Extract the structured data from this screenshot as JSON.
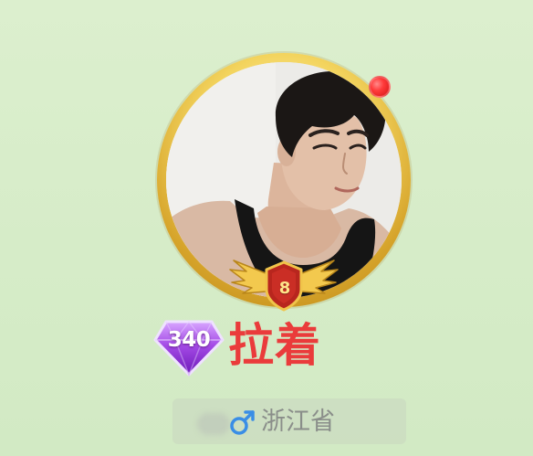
{
  "profile": {
    "username": "拉着",
    "level": "8",
    "gem_level": "340",
    "gender": "male",
    "location": "浙江省",
    "has_notification": true
  },
  "colors": {
    "background": "#d8edca",
    "username": "#ea3b3b",
    "avatar_ring": "#e8c24a",
    "notification_dot": "#ff3a3a",
    "gem": "#9b3fd8",
    "gender_icon": "#3a8ee6",
    "location_text": "#8a8e8a"
  },
  "icons": {
    "avatar": "avatar-photo",
    "level_badge": "winged-shield-badge",
    "gem_badge": "purple-diamond-badge",
    "gender": "male-symbol"
  }
}
